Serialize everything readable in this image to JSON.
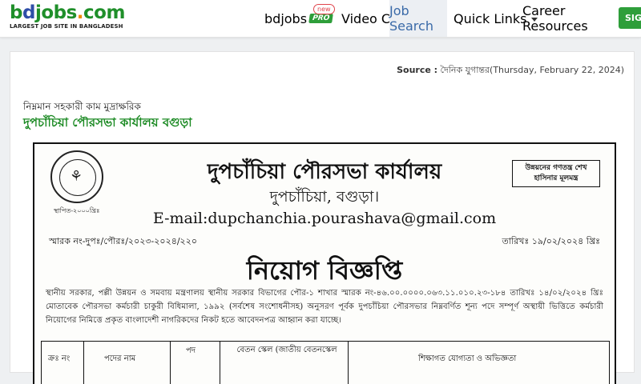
{
  "header": {
    "logo_text_b": "b",
    "logo_text_d": "d",
    "logo_text_jobs": "jobs",
    "logo_text_dot": ".",
    "logo_text_com": "com",
    "logo_tagline": "LARGEST JOB SITE IN BANGLADESH",
    "nav": {
      "pro_label": "bdjobs",
      "pro_badge": "PRO",
      "new_badge": "new",
      "video_cv": "Video CV",
      "job_search": "Job Search",
      "quick_links": "Quick Links",
      "career_resources": "Career Resources",
      "sign_in": "SIG"
    }
  },
  "content": {
    "source_label": "Source :",
    "source_value": "দৈনিক যুগান্তর(Thursday, February 22, 2024)",
    "job_title": "নিম্নমান সহকারী কাম মুদ্রাক্ষরিক",
    "organization": "দুপচাঁচিয়া পৌরসভা কার্যালয় বগুড়া"
  },
  "advertisement": {
    "office_name": "দুপচাঁচিয়া পৌরসভা কার্যালয়",
    "place": "দুপচাঁচিয়া, বগুড়া।",
    "email": "E-mail:dupchanchia.pourashava@gmail.com",
    "memo_no": "স্মারক নং-দুপঃ/পৌরঃ/২০২৩-২০২৪/২২০",
    "memo_date": "তারিখঃ ১৯/০২/২০২৪ খ্রিঃ",
    "notice_title": "নিয়োগ বিজ্ঞপ্তি",
    "slogan": "উন্নয়নের গণতন্ত্র শেখ হাসিনার মূলমন্ত্র",
    "seal_date": "স্থাপিত-২০০০খ্রিঃ",
    "body": "স্থানীয় সরকার, পল্লী উন্নয়ন ও সমবায় মন্ত্রণালয় স্থানীয় সরকার বিভাগের পৌর-১ শাখার স্মারক নং-৪৬.০০.০০০০.০৬৩.১১.০১০.২৩-১৮৪ তারিখঃ ১৪/০২/২০২৪ খ্রিঃ মোতাবেক পৌরসভা কর্মচারী চাকুরী বিধিমালা, ১৯৯২ (সর্বশেষ সংশোধনীসহ) অনুসরণ পূর্বক দুপচাঁচিয়া পৌরসভার নিম্নবর্ণিত শূন্য পদে সম্পূর্ণ অস্থায়ী ভিত্তিতে কর্মচারী নিয়োগের নিমিত্তে প্রকৃত বাংলাদেশী নাগরিকদের নিকট হতে আবেদনপত্র আহ্বান করা যাচ্ছে।",
    "table_headers": [
      "ক্রঃ নং",
      "পদের নাম",
      "পদ",
      "বেতন স্কেল (জাতীয় বেতনস্কেল",
      "শিক্ষাগত যোগ্যতা ও অভিজ্ঞতা"
    ]
  }
}
